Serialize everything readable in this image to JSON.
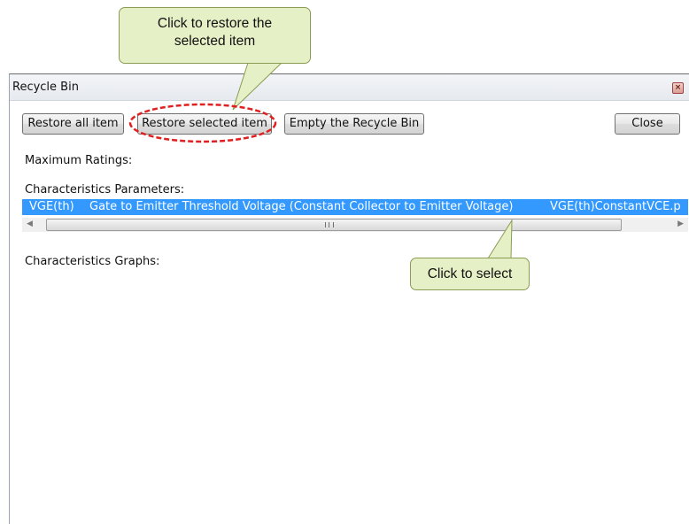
{
  "window": {
    "title": "Recycle Bin",
    "close_glyph": "×"
  },
  "toolbar": {
    "restore_all_label": "Restore all item",
    "restore_selected_label": "Restore selected item",
    "empty_label": "Empty the Recycle Bin",
    "close_label": "Close"
  },
  "sections": {
    "max_ratings": "Maximum Ratings:",
    "char_params": "Characteristics Parameters:",
    "char_graphs": "Characteristics Graphs:"
  },
  "parameters_list": {
    "selected_row": {
      "symbol": "VGE(th)",
      "description": "Gate to Emitter Threshold Voltage (Constant Collector to Emitter Voltage)",
      "file": "VGE(th)ConstantVCE.p"
    }
  },
  "scrollbar": {
    "left_arrow": "◀",
    "right_arrow": "▶"
  },
  "callouts": {
    "restore_line1": "Click to restore the",
    "restore_line2": "selected item",
    "select": "Click to select"
  },
  "colors": {
    "selection": "#3399ff",
    "callout_fill": "#e6f0c6",
    "callout_border": "#8a9c52",
    "highlight_ring": "#e02020"
  }
}
